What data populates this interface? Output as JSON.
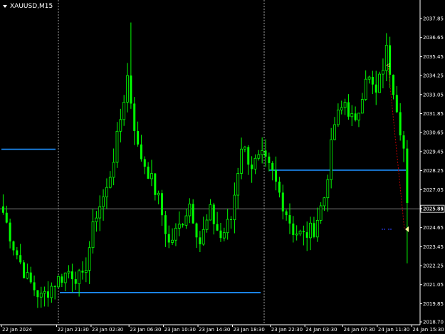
{
  "window": {
    "symbol_label": "XAUUSD,M15"
  },
  "colors": {
    "background": "#000000",
    "candle": "#00ff00",
    "level_line": "#1e90ff",
    "bid_line": "#8a8a8a",
    "separator": "#c8c8c8",
    "axis_text": "#ffffff",
    "trade_line": "#cc0000",
    "price_label_bg": "#000000",
    "trade_marker": "#ffff99"
  },
  "chart_data": {
    "type": "candlestick",
    "symbol": "XAUUSD",
    "timeframe": "M15",
    "x_tick_labels": [
      "22 Jan 2024",
      "22 Jan 21:30",
      "23 Jan 02:30",
      "23 Jan 06:30",
      "23 Jan 10:30",
      "23 Jan 14:30",
      "23 Jan 18:30",
      "23 Jan 22:30",
      "24 Jan 03:30",
      "24 Jan 07:30",
      "24 Jan 11:30",
      "24 Jan 15:30"
    ],
    "y_tick_labels": [
      "2037.85",
      "2036.65",
      "2035.45",
      "2034.25",
      "2033.05",
      "2031.85",
      "2030.65",
      "2029.45",
      "2028.25",
      "2027.05",
      "2025.85",
      "2024.65",
      "2023.45",
      "2022.25",
      "2021.05",
      "2019.85",
      "2018.70"
    ],
    "y_tick_values": [
      2037.85,
      2036.65,
      2035.45,
      2034.25,
      2033.05,
      2031.85,
      2030.65,
      2029.45,
      2028.25,
      2027.05,
      2025.85,
      2024.65,
      2023.45,
      2022.25,
      2021.05,
      2019.85,
      2018.7
    ],
    "ylim": [
      2018.7,
      2037.85
    ],
    "current_price_label": "2025.84",
    "current_price": 2025.84,
    "separators_bar_index": [
      16,
      73
    ],
    "levels": [
      {
        "price": 2029.6,
        "from_bar": 0,
        "to_bar": 15
      },
      {
        "price": 2020.55,
        "from_bar": 16,
        "to_bar": 72
      },
      {
        "price": 2028.28,
        "from_bar": 77,
        "to_bar": 117
      }
    ],
    "trade": {
      "from_bar": 112,
      "from_price": 2034.9,
      "to_bar": 117,
      "to_price": 2024.55
    },
    "pending_marks": [
      {
        "bar": 111,
        "price": 2024.55
      },
      {
        "bar": 113,
        "price": 2024.55
      }
    ],
    "anchors": [
      {
        "bar": 0,
        "price": 2025.6
      },
      {
        "bar": 3,
        "price": 2023.5
      },
      {
        "bar": 7,
        "price": 2021.4
      },
      {
        "bar": 11,
        "price": 2020.2
      },
      {
        "bar": 15,
        "price": 2021.2
      },
      {
        "bar": 19,
        "price": 2021.9
      },
      {
        "bar": 23,
        "price": 2021.3
      },
      {
        "bar": 27,
        "price": 2025.6
      },
      {
        "bar": 30,
        "price": 2027.0
      },
      {
        "bar": 33,
        "price": 2030.2
      },
      {
        "bar": 36,
        "price": 2034.2
      },
      {
        "bar": 39,
        "price": 2029.6
      },
      {
        "bar": 42,
        "price": 2028.2
      },
      {
        "bar": 45,
        "price": 2026.4
      },
      {
        "bar": 48,
        "price": 2023.6
      },
      {
        "bar": 51,
        "price": 2024.7
      },
      {
        "bar": 54,
        "price": 2026.2
      },
      {
        "bar": 57,
        "price": 2023.7
      },
      {
        "bar": 60,
        "price": 2025.6
      },
      {
        "bar": 63,
        "price": 2024.0
      },
      {
        "bar": 66,
        "price": 2025.2
      },
      {
        "bar": 69,
        "price": 2029.9
      },
      {
        "bar": 72,
        "price": 2028.6
      },
      {
        "bar": 75,
        "price": 2029.0
      },
      {
        "bar": 78,
        "price": 2028.0
      },
      {
        "bar": 81,
        "price": 2026.2
      },
      {
        "bar": 84,
        "price": 2024.5
      },
      {
        "bar": 87,
        "price": 2024.1
      },
      {
        "bar": 90,
        "price": 2024.6
      },
      {
        "bar": 93,
        "price": 2026.6
      },
      {
        "bar": 96,
        "price": 2031.2
      },
      {
        "bar": 99,
        "price": 2032.6
      },
      {
        "bar": 102,
        "price": 2031.0
      },
      {
        "bar": 105,
        "price": 2034.4
      },
      {
        "bar": 108,
        "price": 2033.0
      },
      {
        "bar": 111,
        "price": 2035.8
      },
      {
        "bar": 114,
        "price": 2032.4
      },
      {
        "bar": 116,
        "price": 2029.6
      },
      {
        "bar": 117,
        "price": 2025.84
      }
    ],
    "bar_count": 118
  }
}
